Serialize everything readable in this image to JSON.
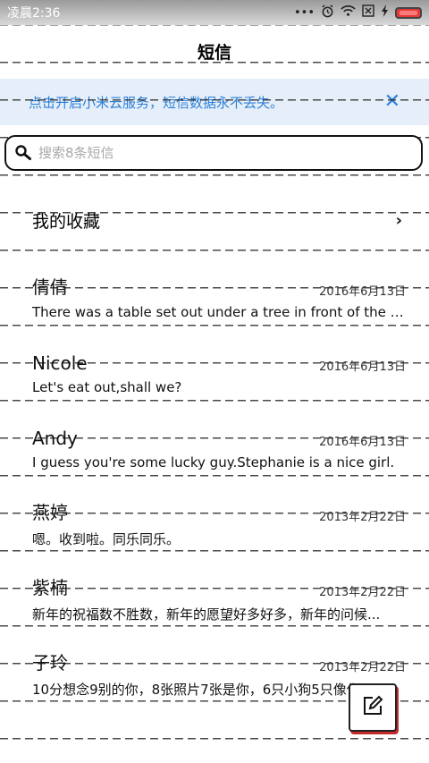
{
  "status_bar": {
    "time": "凌晨2:36",
    "dots": "•••"
  },
  "header": {
    "title": "短信"
  },
  "banner": {
    "text": "点击开启小米云服务，短信数据永不丢失。",
    "close": "✕"
  },
  "search": {
    "placeholder": "搜索8条短信",
    "value": ""
  },
  "favorites": {
    "label": "我的收藏",
    "chevron": "›"
  },
  "conversations": [
    {
      "name": "倩倩",
      "date": "2016年6月13日",
      "snippet": "There was a table set out under a tree in front of the ho..."
    },
    {
      "name": "Nicole",
      "date": "2016年6月13日",
      "snippet": "Let's eat out,shall we?"
    },
    {
      "name": "Andy",
      "date": "2016年6月13日",
      "snippet": "I guess you're some lucky guy.Stephanie is a nice girl."
    },
    {
      "name": "燕婷",
      "date": "2013年2月22日",
      "snippet": "嗯。收到啦。同乐同乐。"
    },
    {
      "name": "紫楠",
      "date": "2013年2月22日",
      "snippet": "新年的祝福数不胜数，新年的愿望好多好多，新年的问候..."
    },
    {
      "name": "子玲",
      "date": "2013年2月22日",
      "snippet": "10分想念9别的你，8张照片7张是你，6只小狗5只像你，4..."
    }
  ],
  "colors": {
    "accent": "#2b7fd8",
    "banner_bg": "#e6eff9",
    "compose_shadow": "#c52a2a"
  },
  "icons": [
    "search-icon",
    "close-icon",
    "chevron-right-icon",
    "compose-icon",
    "alarm-icon",
    "wifi-icon",
    "sim-icon",
    "charging-icon",
    "battery-icon"
  ]
}
